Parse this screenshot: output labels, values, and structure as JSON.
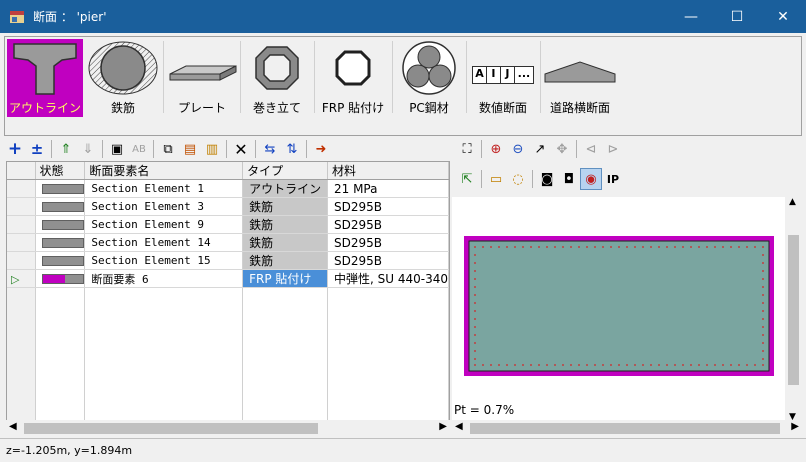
{
  "window": {
    "title": "断面 ： 'pier'",
    "minimize": "—",
    "maximize": "☐",
    "close": "✕"
  },
  "toolbar_big": [
    {
      "label": "アウトライン",
      "selected": true
    },
    {
      "label": "鉄筋"
    },
    {
      "label": "プレート"
    },
    {
      "label": "巻き立て"
    },
    {
      "label": "FRP 貼付け"
    },
    {
      "label": "PC鋼材"
    },
    {
      "label": "数値断面"
    },
    {
      "label": "道路横断面"
    }
  ],
  "numeric_icon_letters": [
    "A",
    "I",
    "J",
    "..."
  ],
  "grid": {
    "headers": [
      "状態",
      "断面要素名",
      "タイプ",
      "材料"
    ],
    "rows": [
      {
        "name": "Section Element 1",
        "type": "アウトライン",
        "material": "21 MPa"
      },
      {
        "name": "Section Element 3",
        "type": "鉄筋",
        "material": "SD295B"
      },
      {
        "name": "Section Element 9",
        "type": "鉄筋",
        "material": "SD295B"
      },
      {
        "name": "Section Element 14",
        "type": "鉄筋",
        "material": "SD295B"
      },
      {
        "name": "Section Element 15",
        "type": "鉄筋",
        "material": "SD295B"
      },
      {
        "name": "断面要素 6",
        "type": "FRP 貼付け",
        "material": "中弾性, SU 440-340",
        "current": true
      }
    ]
  },
  "preview": {
    "pt": "Pt = 0.7%",
    "section_fill": "#7aa5a0",
    "outline_color": "#c000c0"
  },
  "status": "z=-1.205m, y=1.894m",
  "colors": {
    "titlebar": "#1a5f9c",
    "selected": "#c000c0",
    "selected_type": "#4a8fd8"
  }
}
